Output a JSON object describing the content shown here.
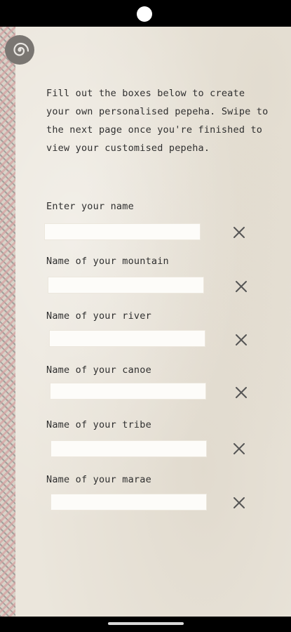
{
  "intro_text": "Fill out the boxes below to create your own personalised pepeha. Swipe to the next page once you're finished to view your customised pepeha.",
  "fields": [
    {
      "label": "Enter your name",
      "value": "",
      "placeholder": ""
    },
    {
      "label": "Name of your mountain",
      "value": "",
      "placeholder": ""
    },
    {
      "label": "Name of your river",
      "value": "",
      "placeholder": ""
    },
    {
      "label": "Name of your canoe",
      "value": "",
      "placeholder": ""
    },
    {
      "label": "Name of your tribe",
      "value": "",
      "placeholder": ""
    },
    {
      "label": "Name of your marae",
      "value": "",
      "placeholder": ""
    }
  ],
  "icons": {
    "top_left": "koru-spiral-icon",
    "clear": "close-icon"
  },
  "colors": {
    "background": "#ebe6dc",
    "text": "#2f2f2f",
    "input_bg": "#fdfcf9",
    "icon": "#555555"
  }
}
